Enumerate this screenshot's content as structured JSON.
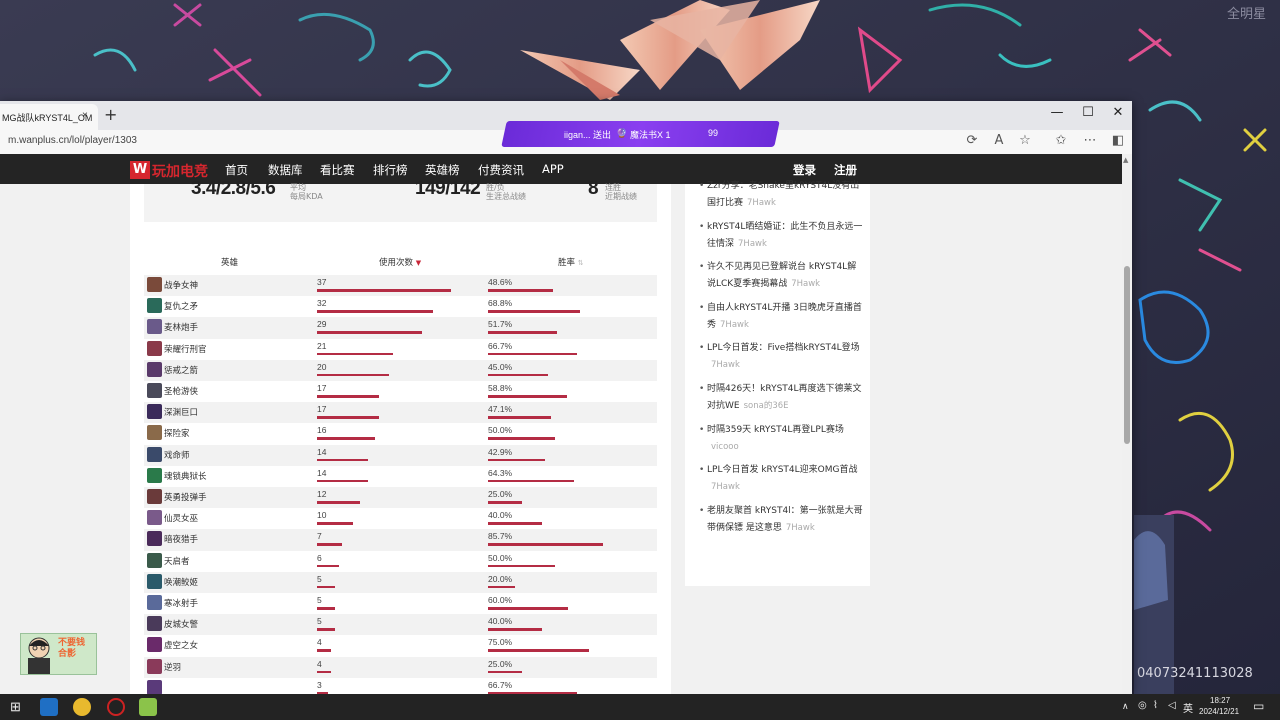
{
  "overlay": {
    "top_right_label": "全明星",
    "viewer_id": "04073241113028"
  },
  "browser": {
    "tab_title": "MG战队kRYST4L_OM",
    "tab_close": "×",
    "new_tab": "+",
    "url": "m.wanplus.cn/lol/player/1303",
    "window_buttons": [
      "—",
      "☐",
      "✕"
    ],
    "addr_icons": [
      "refresh-icon",
      "read-aloud-icon",
      "favorite-icon",
      "favorites-bar-icon",
      "more-icon",
      "sidebar-icon"
    ],
    "live_banner": {
      "user": "iigan... 送出",
      "gift": "魔法书X 1",
      "count": "99"
    }
  },
  "site": {
    "logo": "玩加电竞",
    "nav": [
      "首页",
      "数据库",
      "看比赛",
      "排行榜",
      "英雄榜",
      "付费资讯",
      "APP"
    ],
    "login": "登录",
    "register": "注册"
  },
  "stats": [
    {
      "value": "3.4/2.8/5.6",
      "label1": "平均",
      "label2": "每局KDA"
    },
    {
      "value": "149/142",
      "label1": "胜/负",
      "label2": "生涯总战绩"
    },
    {
      "value": "8",
      "label1": "连胜",
      "label2": "近期战绩"
    }
  ],
  "table": {
    "headers": {
      "hero": "英雄",
      "count": "使用次数",
      "winrate": "胜率"
    },
    "rows": [
      {
        "name": "战争女神",
        "count": 37,
        "winrate": "48.6%",
        "color": "#7a4a3a"
      },
      {
        "name": "复仇之矛",
        "count": 32,
        "winrate": "68.8%",
        "color": "#2a6a5a"
      },
      {
        "name": "麦林炮手",
        "count": 29,
        "winrate": "51.7%",
        "color": "#6a5a8a"
      },
      {
        "name": "荣耀行刑官",
        "count": 21,
        "winrate": "66.7%",
        "color": "#8a3a4a"
      },
      {
        "name": "惩戒之箭",
        "count": 20,
        "winrate": "45.0%",
        "color": "#5a3a6a"
      },
      {
        "name": "圣枪游侠",
        "count": 17,
        "winrate": "58.8%",
        "color": "#4a4a5a"
      },
      {
        "name": "深渊巨口",
        "count": 17,
        "winrate": "47.1%",
        "color": "#3a2a5a"
      },
      {
        "name": "探险家",
        "count": 16,
        "winrate": "50.0%",
        "color": "#8a6a4a"
      },
      {
        "name": "戏命师",
        "count": 14,
        "winrate": "42.9%",
        "color": "#3a4a6a"
      },
      {
        "name": "魂锁典狱长",
        "count": 14,
        "winrate": "64.3%",
        "color": "#2a7a4a"
      },
      {
        "name": "英勇投弹手",
        "count": 12,
        "winrate": "25.0%",
        "color": "#6a3a3a"
      },
      {
        "name": "仙灵女巫",
        "count": 10,
        "winrate": "40.0%",
        "color": "#7a5a8a"
      },
      {
        "name": "暗夜猎手",
        "count": 7,
        "winrate": "85.7%",
        "color": "#4a2a5a"
      },
      {
        "name": "天启者",
        "count": 6,
        "winrate": "50.0%",
        "color": "#3a5a4a"
      },
      {
        "name": "唤潮鲛姬",
        "count": 5,
        "winrate": "20.0%",
        "color": "#2a5a6a"
      },
      {
        "name": "寒冰射手",
        "count": 5,
        "winrate": "60.0%",
        "color": "#5a6a9a"
      },
      {
        "name": "皮城女警",
        "count": 5,
        "winrate": "40.0%",
        "color": "#4a3a5a"
      },
      {
        "name": "虚空之女",
        "count": 4,
        "winrate": "75.0%",
        "color": "#6a2a6a"
      },
      {
        "name": "逆羽",
        "count": 4,
        "winrate": "25.0%",
        "color": "#8a3a5a"
      },
      {
        "name": "",
        "count": 3,
        "winrate": "66.7%",
        "color": "#5a3a7a"
      }
    ]
  },
  "news": [
    {
      "text": "Zzr分享：老Snake里kRYST4L没有出国打比赛",
      "author": "7Hawk"
    },
    {
      "text": "kRYST4L晒结婚证：此生不负且永远一往情深",
      "author": "7Hawk"
    },
    {
      "text": "许久不见再见已登解说台 kRYST4L解说LCK夏季赛揭幕战",
      "author": "7Hawk"
    },
    {
      "text": "自由人kRYST4L开播 3日晚虎牙直播首秀",
      "author": "7Hawk"
    },
    {
      "text": "LPL今日首发：Five搭档kRYST4L登场",
      "author": "7Hawk"
    },
    {
      "text": "时隔426天！kRYST4L再度选下德莱文对抗WE",
      "author": "sona的36E"
    },
    {
      "text": "时隔359天 kRYST4L再登LPL赛场",
      "author": "vicooo"
    },
    {
      "text": "LPL今日首发 kRYST4L迎来OMG首战",
      "author": "7Hawk"
    },
    {
      "text": "老朋友聚首 kRYST4l：第一张就是大哥带俩保镖 是这意思",
      "author": "7Hawk"
    }
  ],
  "taskbar": {
    "time": "18:27",
    "date": "2024/12/21",
    "ime": "英"
  },
  "streamer_cam_text": "不要钱 合影"
}
